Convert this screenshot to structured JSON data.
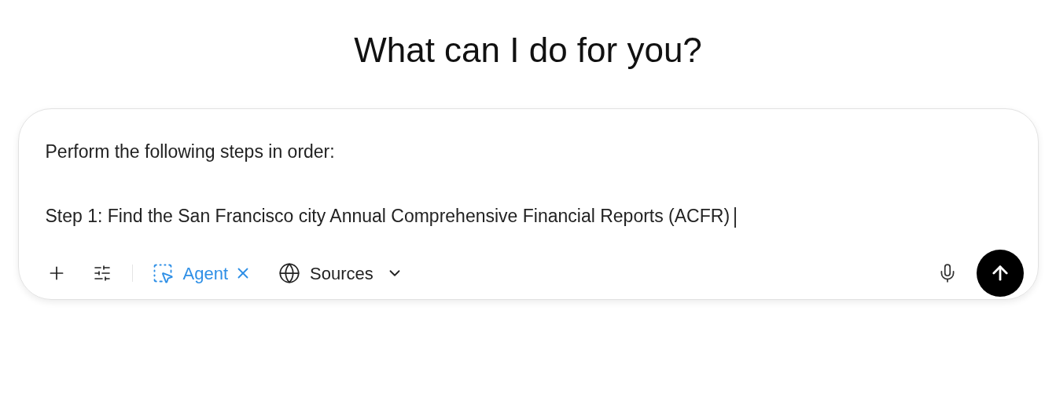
{
  "heading": "What can I do for you?",
  "prompt": {
    "value": "Perform the following steps in order:\n\nStep 1: Find the San Francisco city Annual Comprehensive Financial Reports (ACFR)",
    "focused": true
  },
  "toolbar": {
    "agent": {
      "label": "Agent",
      "selected": true
    },
    "sources": {
      "label": "Sources"
    }
  }
}
